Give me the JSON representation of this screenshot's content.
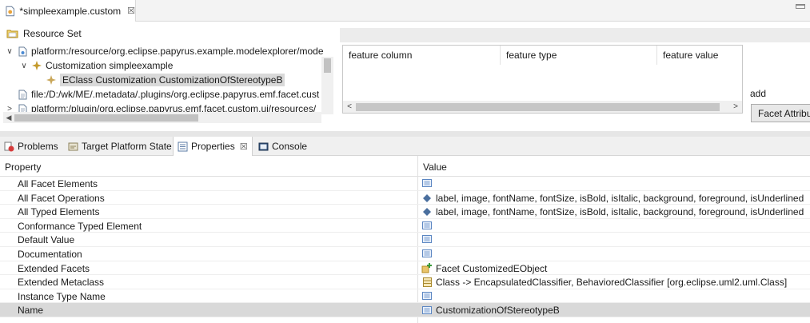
{
  "editor": {
    "tab_title": "*simpleexample.custom",
    "close_glyph": "☒",
    "resource_set_label": "Resource Set",
    "tree": [
      {
        "expander": "∨",
        "icon": "file-icon",
        "label": "platform:/resource/org.eclipse.papyrus.example.modelexplorer/mode"
      },
      {
        "expander": "∨",
        "icon": "customization-icon",
        "label": "Customization simpleexample"
      },
      {
        "expander": "",
        "icon": "eclass-customization-icon",
        "label": "EClass Customization CustomizationOfStereotypeB"
      },
      {
        "expander": "",
        "icon": "file-icon",
        "label": "file:/D:/wk/ME/.metadata/.plugins/org.eclipse.papyrus.emf.facet.cust"
      },
      {
        "expander": ">",
        "icon": "file-icon",
        "label": "platform:/plugin/org.eclipse.papyrus.emf.facet.custom.ui/resources/"
      }
    ],
    "feature_table": {
      "columns": [
        "feature column",
        "feature type",
        "feature value"
      ],
      "scroll_left": "<",
      "scroll_right": ">"
    },
    "add_label": "add",
    "facet_button_label": "Facet Attribu"
  },
  "views": {
    "tabs": [
      {
        "label": "Problems",
        "icon": "problems-icon",
        "closable": false
      },
      {
        "label": "Target Platform State",
        "icon": "target-icon",
        "closable": false
      },
      {
        "label": "Properties",
        "icon": "properties-icon",
        "closable": true
      },
      {
        "label": "Console",
        "icon": "console-icon",
        "closable": false
      }
    ]
  },
  "properties": {
    "header_property": "Property",
    "header_value": "Value",
    "rows": [
      {
        "name": "All Facet Elements",
        "icon": "list-icon",
        "value": ""
      },
      {
        "name": "All Facet Operations",
        "icon": "operation-icon",
        "value": "label, image, fontName, fontSize, isBold, isItalic, background, foreground, isUnderlined"
      },
      {
        "name": "All Typed Elements",
        "icon": "operation-icon",
        "value": "label, image, fontName, fontSize, isBold, isItalic, background, foreground, isUnderlined"
      },
      {
        "name": "Conformance Typed Element",
        "icon": "list-icon",
        "value": ""
      },
      {
        "name": "Default Value",
        "icon": "list-icon",
        "value": ""
      },
      {
        "name": "Documentation",
        "icon": "list-icon",
        "value": ""
      },
      {
        "name": "Extended Facets",
        "icon": "facet-icon",
        "value": "Facet CustomizedEObject"
      },
      {
        "name": "Extended Metaclass",
        "icon": "class-icon",
        "value": "Class -> EncapsulatedClassifier, BehavioredClassifier [org.eclipse.uml2.uml.Class]"
      },
      {
        "name": "Instance Type Name",
        "icon": "list-icon",
        "value": ""
      },
      {
        "name": "Name",
        "icon": "list-icon",
        "value": "CustomizationOfStereotypeB"
      }
    ]
  }
}
